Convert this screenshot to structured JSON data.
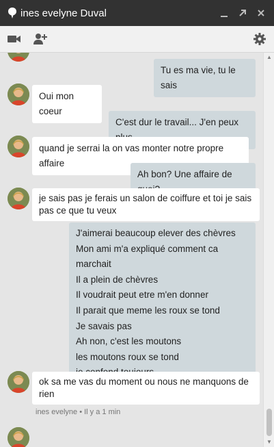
{
  "window": {
    "title": "ines evelyne Duval",
    "controls": {
      "minimize_icon": "minimize-icon",
      "popout_icon": "popout-icon",
      "close_icon": "close-icon"
    }
  },
  "toolbar": {
    "video_icon": "video-camera-icon",
    "add_person_icon": "add-person-icon",
    "settings_icon": "gear-icon"
  },
  "colors": {
    "titlebar": "#323232",
    "incoming_bubble": "#ffffff",
    "outgoing_bubble": "#cfd8dc",
    "background": "#e5e5e5"
  },
  "messages": [
    {
      "from": "me",
      "text": "Tu es ma vie, tu le sais"
    },
    {
      "from": "contact",
      "text": "Oui mon coeur"
    },
    {
      "from": "me",
      "text": "C'est dur le travail... J'en peux plus"
    },
    {
      "from": "contact",
      "text": "quand je serrai la on vas monter notre propre affaire"
    },
    {
      "from": "me",
      "text": "Ah bon? Une affaire de quoi?"
    },
    {
      "from": "contact",
      "lines": [
        "je sais pas je ferais un salon de coiffure et toi je sais",
        "pas ce que tu veux"
      ]
    },
    {
      "from": "me",
      "lines": [
        "J'aimerai beaucoup elever des chèvres",
        "Mon ami m'a expliqué comment ca marchait",
        "Il a plein de chèvres",
        "Il voudrait peut etre m'en donner",
        "Il parait que meme les roux se tond",
        "Je savais pas",
        "Ah non, c'est les moutons",
        "les moutons roux se tond",
        "je confond toujours"
      ]
    },
    {
      "from": "contact",
      "lines": [
        "ok sa me vas du moment ou nous ne manquons de",
        "rien"
      ]
    }
  ],
  "last_meta": "ines evelyne • Il y a 1 min"
}
